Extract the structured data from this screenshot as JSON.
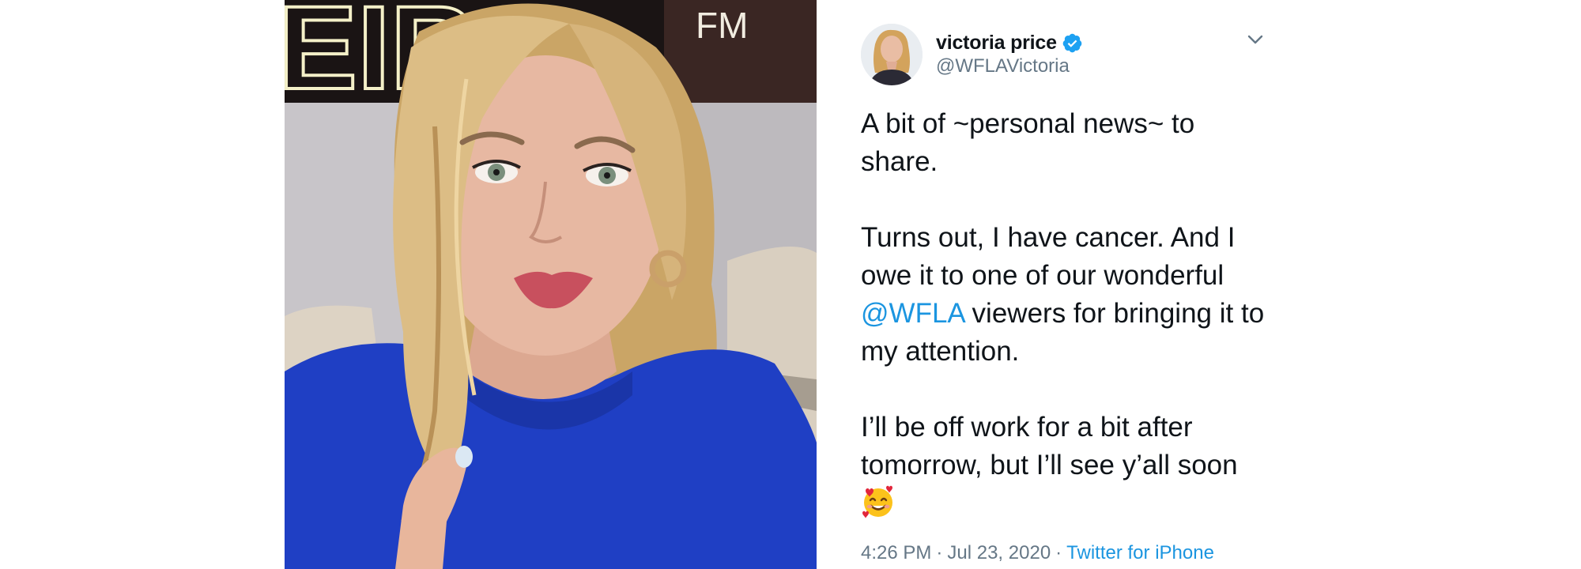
{
  "photo": {
    "sign_text": "EIRA",
    "sign_corner_text": "FM",
    "colors": {
      "wall": "#c9c6c8",
      "hair": "#d8b77a",
      "skin": "#e6b7a0",
      "shirt": "#1f3fc4",
      "lips": "#c8505e"
    }
  },
  "tweet": {
    "user": {
      "display_name": "victoria price",
      "handle": "@WFLAVictoria",
      "verified": true
    },
    "body": {
      "p1": "A bit of ~personal news~ to share.",
      "p2_before": "Turns out, I have cancer. And I owe it to one of our wonderful ",
      "p2_mention": "@WFLA",
      "p2_after": " viewers for bringing it to my attention.",
      "p3": "I’ll be off work for a bit after tomorrow, but I’ll see y’all soon"
    },
    "meta": {
      "time": "4:26 PM",
      "separator": "·",
      "date": "Jul 23, 2020",
      "source": "Twitter for iPhone"
    },
    "icons": [
      "verified-badge-icon",
      "chevron-down-icon",
      "smiling-face-with-hearts-emoji"
    ],
    "colors": {
      "text": "#0f1419",
      "secondary": "#657786",
      "link": "#1b95e0",
      "verified": "#1da1f2"
    }
  }
}
